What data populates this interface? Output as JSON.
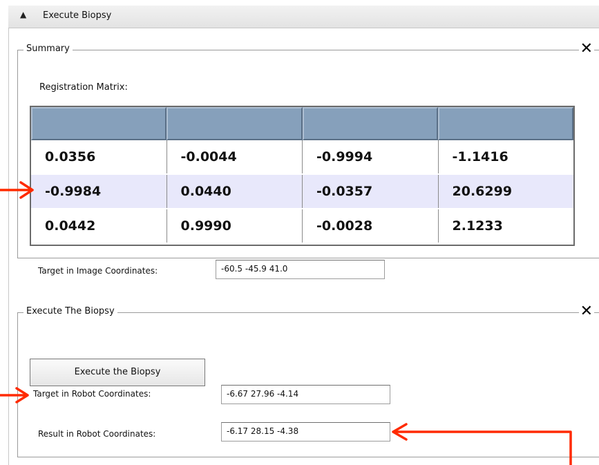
{
  "header": {
    "title": "Execute Biopsy",
    "toggle_icon": "collapse-triangle-icon"
  },
  "summary": {
    "label": "Summary",
    "matrix_label": "Registration Matrix:",
    "matrix": {
      "rows": [
        [
          "0.0356",
          "-0.0044",
          "-0.9994",
          "-1.1416"
        ],
        [
          "-0.9984",
          "0.0440",
          "-0.0357",
          "20.6299"
        ],
        [
          "0.0442",
          "0.9990",
          "-0.0028",
          "2.1233"
        ]
      ]
    },
    "target_image_label": "Target in Image Coordinates:",
    "target_image_value": "-60.5 -45.9 41.0"
  },
  "execute": {
    "label": "Execute The Biopsy",
    "button_label": "Execute the Biopsy",
    "target_robot_label": "Target in Robot Coordinates:",
    "target_robot_value": "-6.67 27.96 -4.14",
    "result_robot_label": "Result in Robot Coordinates:",
    "result_robot_value": "-6.17 28.15 -4.38"
  },
  "colors": {
    "accent_arrow": "#ff2a00",
    "table_header": "#86a0bb",
    "row_highlight": "#e8e8fb"
  }
}
